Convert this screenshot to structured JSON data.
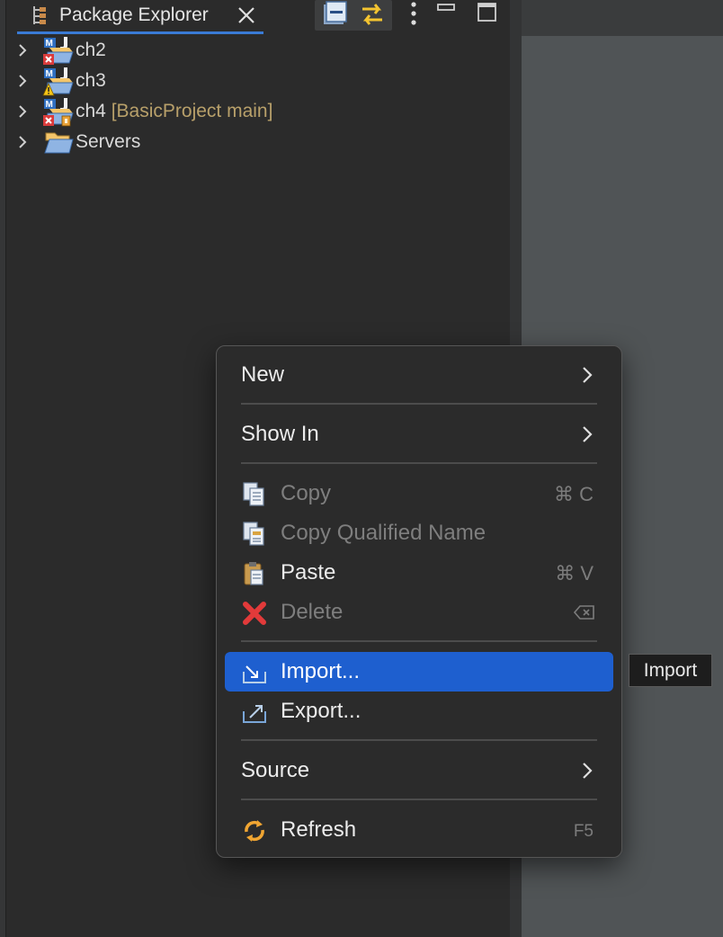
{
  "view": {
    "title": "Package Explorer",
    "toolbar": {
      "collapse_all": "collapse-all-icon",
      "link_with_editor": "link-with-editor-icon",
      "view_menu": "kebab-icon",
      "minimize": "minimize-icon",
      "maximize": "maximize-icon"
    }
  },
  "tree": {
    "items": [
      {
        "label": "ch2",
        "decoration": "",
        "icon": "maven-java-project-error-icon"
      },
      {
        "label": "ch3",
        "decoration": "",
        "icon": "maven-java-project-warning-icon"
      },
      {
        "label": "ch4",
        "decoration": "[BasicProject main]",
        "icon": "maven-java-project-git-error-icon"
      },
      {
        "label": "Servers",
        "decoration": "",
        "icon": "folder-icon"
      }
    ]
  },
  "menu": {
    "new": "New",
    "show_in": "Show In",
    "copy": "Copy",
    "copy_key": "⌘ C",
    "copy_qualified": "Copy Qualified Name",
    "paste": "Paste",
    "paste_key": "⌘ V",
    "delete": "Delete",
    "import": "Import...",
    "export": "Export...",
    "source": "Source",
    "refresh": "Refresh",
    "refresh_key": "F5"
  },
  "tooltip": {
    "text": "Import"
  },
  "colors": {
    "selection": "#1e5fcf",
    "decoration": "#b8a06a",
    "tab_underline": "#3a7bd5"
  }
}
